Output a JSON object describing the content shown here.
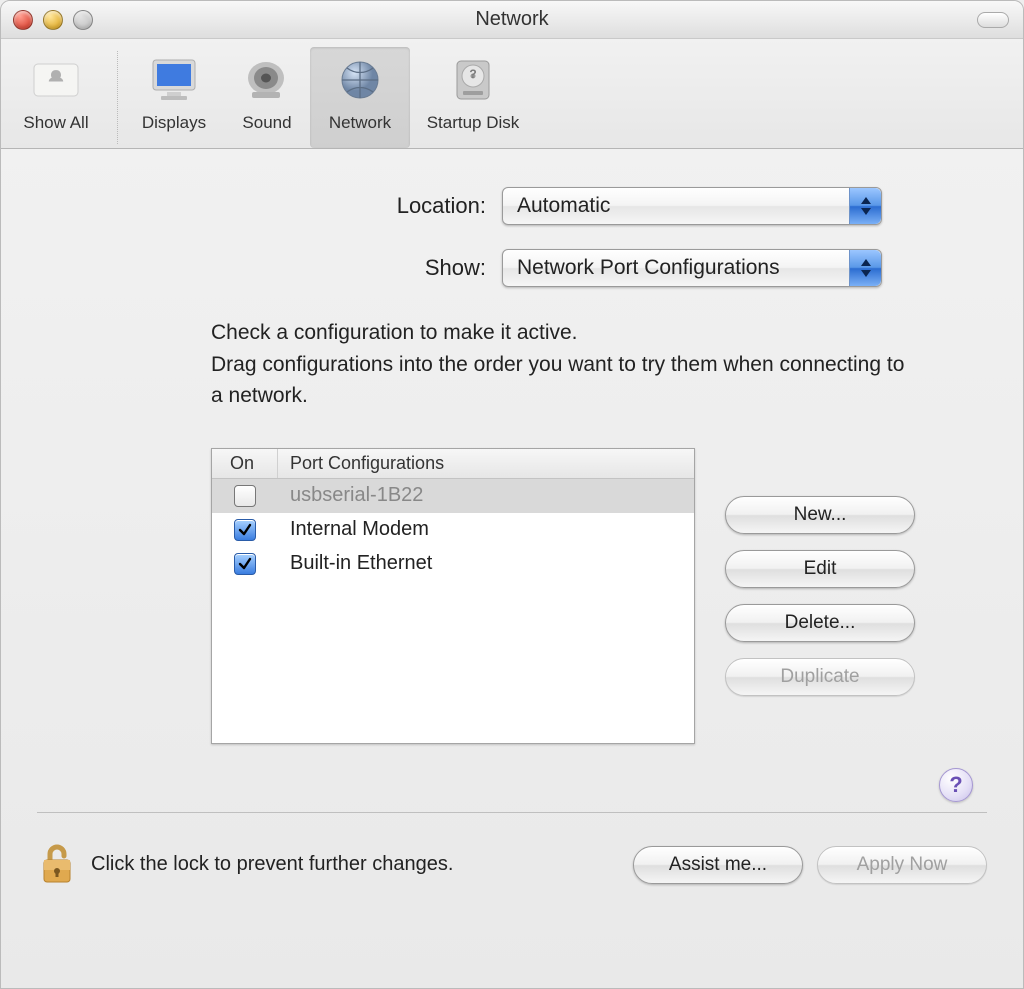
{
  "window": {
    "title": "Network"
  },
  "toolbar": {
    "items": [
      {
        "label": "Show All"
      },
      {
        "label": "Displays"
      },
      {
        "label": "Sound"
      },
      {
        "label": "Network"
      },
      {
        "label": "Startup Disk"
      }
    ]
  },
  "form": {
    "location_label": "Location:",
    "location_value": "Automatic",
    "show_label": "Show:",
    "show_value": "Network Port Configurations"
  },
  "instructions_line1": "Check a configuration to make it active.",
  "instructions_line2": "Drag configurations into the order you want to try them when connecting to a network.",
  "list": {
    "header_on": "On",
    "header_port": "Port Configurations",
    "rows": [
      {
        "on": false,
        "name": "usbserial-1B22",
        "selected": true
      },
      {
        "on": true,
        "name": "Internal Modem",
        "selected": false
      },
      {
        "on": true,
        "name": "Built-in Ethernet",
        "selected": false
      }
    ]
  },
  "side_buttons": {
    "new": "New...",
    "edit": "Edit",
    "delete": "Delete...",
    "duplicate": "Duplicate"
  },
  "help": "?",
  "footer": {
    "lock_text": "Click the lock to prevent further changes.",
    "assist": "Assist me...",
    "apply": "Apply Now"
  }
}
